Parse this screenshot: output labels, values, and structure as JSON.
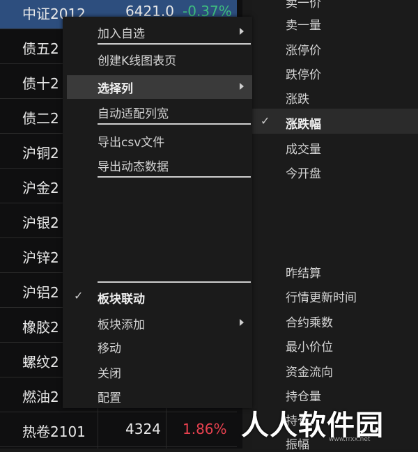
{
  "table": {
    "rows": [
      {
        "name": "中证2012",
        "price": "6421.0",
        "change": "-0.37%",
        "change_color": "#3fbf7f",
        "selected": true
      },
      {
        "name": "债五2",
        "price": "",
        "change": ""
      },
      {
        "name": "债十2",
        "price": "",
        "change": ""
      },
      {
        "name": "债二2",
        "price": "",
        "change": ""
      },
      {
        "name": "沪铜2",
        "price": "",
        "change": ""
      },
      {
        "name": "沪金2",
        "price": "",
        "change": ""
      },
      {
        "name": "沪银2",
        "price": "",
        "change": ""
      },
      {
        "name": "沪锌2",
        "price": "",
        "change": ""
      },
      {
        "name": "沪铝2",
        "price": "",
        "change": ""
      },
      {
        "name": "橡胶2",
        "price": "",
        "change": ""
      },
      {
        "name": "螺纹2",
        "price": "",
        "change": ""
      },
      {
        "name": "燃油2",
        "price": "",
        "change": ""
      },
      {
        "name": "热卷2101",
        "price": "4324",
        "change": "1.86%",
        "change_color": "#e8414f"
      }
    ]
  },
  "menu": {
    "items": [
      {
        "label": "加入自选",
        "has_submenu": true
      },
      {
        "label": "创建K线图表页"
      },
      {
        "label": "选择列",
        "has_submenu": true,
        "highlighted": true
      },
      {
        "label": "自动适配列宽"
      },
      {
        "label": "导出csv文件"
      },
      {
        "label": "导出动态数据"
      },
      {
        "label": "板块联动",
        "checked": true
      },
      {
        "label": "板块添加",
        "has_submenu": true
      },
      {
        "label": "移动"
      },
      {
        "label": "关闭"
      },
      {
        "label": "配置"
      }
    ]
  },
  "submenu": {
    "items": [
      {
        "label": "卖一价"
      },
      {
        "label": "卖一量"
      },
      {
        "label": "涨停价"
      },
      {
        "label": "跌停价"
      },
      {
        "label": "涨跌"
      },
      {
        "label": "涨跌幅",
        "checked": true
      },
      {
        "label": "成交量"
      },
      {
        "label": "今开盘"
      },
      {
        "label": "昨结算"
      },
      {
        "label": "行情更新时间"
      },
      {
        "label": "合约乘数"
      },
      {
        "label": "最小价位"
      },
      {
        "label": "资金流向"
      },
      {
        "label": "持仓量"
      },
      {
        "label": "持仓"
      },
      {
        "label": "振幅"
      }
    ]
  },
  "watermark": {
    "text": "人人软件园",
    "sub": "www.rrxx.net"
  },
  "icons": {
    "check": "checkmark-icon",
    "arrow": "chevron-right-icon"
  }
}
